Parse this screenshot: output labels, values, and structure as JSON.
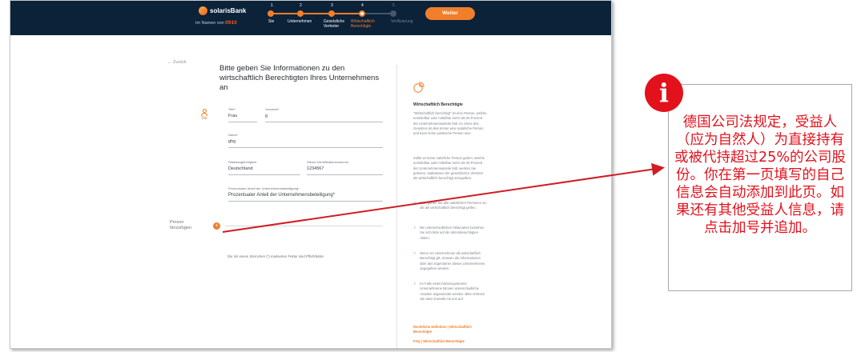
{
  "topbar": {
    "brand": "solarisBank",
    "on_behalf_prefix": "Im Namen von",
    "on_behalf_name": "0910",
    "steps": [
      {
        "num": "1",
        "label": "Sie"
      },
      {
        "num": "2",
        "label": "Unternehmen"
      },
      {
        "num": "3",
        "label": "Gesetzliche\nVertreter"
      },
      {
        "num": "4",
        "label": "Wirtschaftlich\nBerechtigte"
      },
      {
        "num": "5",
        "label": "Verifizierung"
      }
    ],
    "next_button": "Weiter"
  },
  "form": {
    "back_link": "← Zurück",
    "title": "Bitte geben Sie Informationen zu den wirtschaftlich Berechtigten Ihres Unternehmens an",
    "person_label": "Sie",
    "title_label": "Titel*",
    "title_value": "Frau",
    "firstname_label": "Vorname*",
    "firstname_value": "g",
    "lastname_label": "Name*",
    "lastname_value": "ghg",
    "nationality_label": "Staatsangehörigkeit",
    "nationality_value": "Deutschland",
    "taxid_label": "Steuer-Identifikationsnummer",
    "taxid_value": "1234567",
    "share_label": "Prozentualer Anteil der Unternehmensbeteiligung*",
    "share_placeholder": "Prozentualer Anteil der Unternehmensbeteiligung*",
    "add_person_label": "Person\nhinzufügen",
    "add_person_symbol": "+",
    "required_note": "Die mit einem Sternchen (*) markierten Felder sind Pflichtfelder"
  },
  "info_panel": {
    "title": "Wirtschaftlich Berechtigte",
    "para1": "\"Wirtschaftlich berechtigt\" ist eine Person, welche unmittelbar oder mittelbar mehr als 25 Prozent der Unternehmensanteile hält. Im Sinne des Gesetzes ist dies immer eine natürliche Person und kann keine juristische Person sein.",
    "para2": "Sollte es keine natürliche Person geben, welche unmittelbar oder mittelbar mehr als 25 Prozent der Unternehmensanteile hält, werden Sie gebeten, stattdessen die gesetzlichen Vertreter als wirtschaftlich berechtigt anzugeben.",
    "checks": [
      "Bitte geben Sie alle natürlichen Personen an, die als wirtschaftlich berechtigt gelten.",
      "Bei unterschiedlichen Aktienarten beziehen Sie sich bitte auf die stimmberechtigten Aktien.",
      "Wenn ein Unternehmen als wirtschaftlich Berechtigt gilt, müssen die Informationen über den Eigentümer dieses Unternehmens angegeben werden.",
      "Im Falle eines börsenquotierten Unternehmens können unterschiedliche Ansätze angewendet werden. Bitte nehmen Sie dann Kontakt mit uns auf."
    ],
    "link1": "Rechtliche Definition | Wirtschaftlich Berechtigte",
    "link2": "FAQ | Wirtschaftlich Berechtigte"
  },
  "annotation": {
    "badge": "i",
    "text": "德国公司法规定，受益人（应为自然人）为直接持有或被代持超过25%的公司股份。你在第一页填写的自己信息会自动添加到此页。如果还有其他受益人信息，请点击加号并追加。"
  },
  "colors": {
    "topbar": "#0b2239",
    "accent": "#f07e2a",
    "annotation_red": "#e3111c"
  }
}
